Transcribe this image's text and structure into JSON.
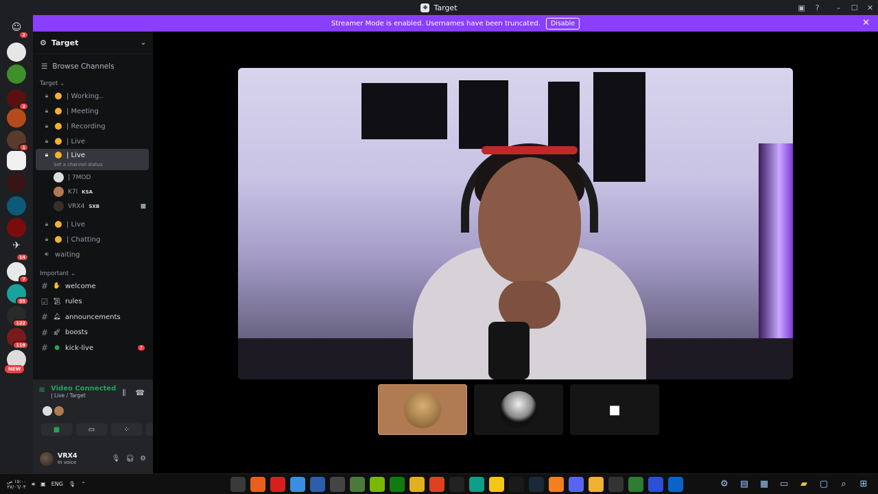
{
  "window": {
    "title": "Target"
  },
  "banner": {
    "text": "Streamer Mode is enabled. Usernames have been truncated.",
    "disable_label": "Disable"
  },
  "rail": {
    "badges": [
      "2",
      "2",
      "1",
      "14",
      "7",
      "55",
      "122",
      "119"
    ],
    "new_label": "NEW"
  },
  "server": {
    "name": "Target",
    "browse_label": "Browse Channels"
  },
  "categories": {
    "target": "Target",
    "important": "Important"
  },
  "voice_channels": {
    "c1": "| Working..",
    "c2": "| Meeting",
    "c3": "| Recording",
    "c4": "| Live",
    "c5": "| Live",
    "c5_status": "Set a channel status",
    "c6": "| Live",
    "c7": "| Chatting",
    "c8": "waiting"
  },
  "voice_users": [
    {
      "name": "| 7MOD",
      "tag": ""
    },
    {
      "name": "K7l",
      "tag": "KSA"
    },
    {
      "name": "VRX4",
      "tag": "SXB"
    }
  ],
  "text_channels": {
    "t1": "welcome",
    "t2": "rules",
    "t3": "announcements",
    "t4": "boosts",
    "t5": "kick-live",
    "t5_unread": "7"
  },
  "voice_panel": {
    "status": "Video Connected",
    "location": "| Live / Target"
  },
  "user_panel": {
    "name": "VRX4",
    "status": "In voice"
  },
  "taskbar": {
    "lang": "ENG",
    "time": "١٥:٠٠ ص",
    "date": "٢٧/٠٦/٠٣"
  },
  "colors": {
    "accent": "#8a3ffc",
    "online": "#23a55a",
    "danger": "#f23f43"
  }
}
